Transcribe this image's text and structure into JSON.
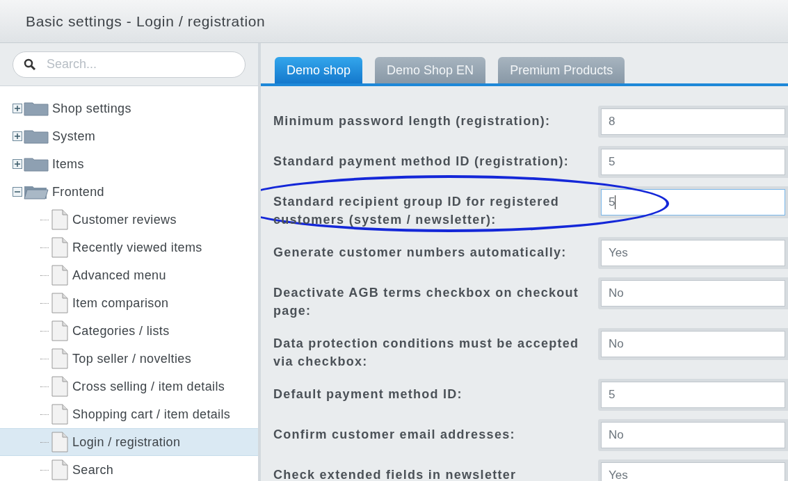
{
  "window": {
    "title": "Basic settings - Login / registration"
  },
  "search": {
    "placeholder": "Search..."
  },
  "tree": [
    {
      "label": "Shop settings",
      "expanded": false
    },
    {
      "label": "System",
      "expanded": false
    },
    {
      "label": "Items",
      "expanded": false
    },
    {
      "label": "Frontend",
      "expanded": true,
      "children": [
        {
          "label": "Customer reviews",
          "selected": false
        },
        {
          "label": "Recently viewed items",
          "selected": false
        },
        {
          "label": "Advanced menu",
          "selected": false
        },
        {
          "label": "Item comparison",
          "selected": false
        },
        {
          "label": "Categories / lists",
          "selected": false
        },
        {
          "label": "Top seller / novelties",
          "selected": false
        },
        {
          "label": "Cross selling / item details",
          "selected": false
        },
        {
          "label": "Shopping cart / item details",
          "selected": false
        },
        {
          "label": "Login / registration",
          "selected": true
        },
        {
          "label": "Search",
          "selected": false
        }
      ]
    }
  ],
  "tabs": [
    {
      "label": "Demo shop",
      "selected": true
    },
    {
      "label": "Demo Shop EN",
      "selected": false
    },
    {
      "label": "Premium Products",
      "selected": false
    }
  ],
  "settings": [
    {
      "label": "Minimum password length (registration):",
      "value": "8",
      "focused": false,
      "highlighted": false
    },
    {
      "label": "Standard payment method ID (registration):",
      "value": "5",
      "focused": false,
      "highlighted": false
    },
    {
      "label": "Standard recipient group ID for registered customers (system / newsletter):",
      "value": "5",
      "focused": true,
      "highlighted": true
    },
    {
      "label": "Generate customer numbers automatically:",
      "value": "Yes",
      "focused": false,
      "highlighted": false
    },
    {
      "label": "Deactivate AGB terms checkbox on checkout page:",
      "value": "No",
      "focused": false,
      "highlighted": false
    },
    {
      "label": "Data protection conditions must be accepted via checkbox:",
      "value": "No",
      "focused": false,
      "highlighted": false
    },
    {
      "label": "Default payment method ID:",
      "value": "5",
      "focused": false,
      "highlighted": false
    },
    {
      "label": "Confirm customer email addresses:",
      "value": "No",
      "focused": false,
      "highlighted": false
    },
    {
      "label": "Check extended fields in newsletter",
      "value": "Yes",
      "focused": false,
      "highlighted": false
    }
  ]
}
